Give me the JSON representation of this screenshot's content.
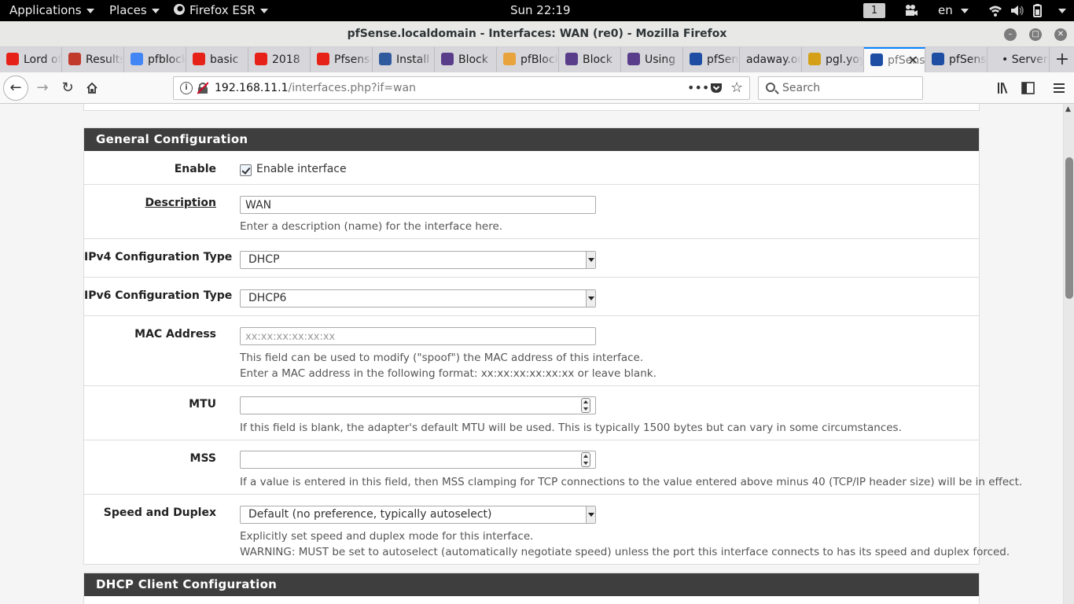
{
  "topbar": {
    "applications": "Applications",
    "places": "Places",
    "app_name": "Firefox ESR",
    "clock": "Sun 22:19",
    "workspace": "1",
    "language": "en"
  },
  "window": {
    "title": "pfSense.localdomain - Interfaces: WAN (re0) - Mozilla Firefox"
  },
  "tabs": [
    {
      "label": "Lord of",
      "icon": "youtube-icon",
      "color": "#e62117"
    },
    {
      "label": "Results",
      "icon": "results-icon",
      "color": "#c0392b"
    },
    {
      "label": "pfblockerng",
      "icon": "google-icon",
      "color": "#4285f4"
    },
    {
      "label": "basic",
      "icon": "youtube-icon",
      "color": "#e62117"
    },
    {
      "label": "2018",
      "icon": "youtube-icon",
      "color": "#e62117"
    },
    {
      "label": "Pfsense",
      "icon": "youtube-icon",
      "color": "#e62117"
    },
    {
      "label": "Install",
      "icon": "info-icon",
      "color": "#2f5a9e"
    },
    {
      "label": "Block",
      "icon": "circle-icon",
      "color": "#5a3d8a"
    },
    {
      "label": "pfBlocker",
      "icon": "forum-icon",
      "color": "#e8a33d"
    },
    {
      "label": "Block",
      "icon": "circle-icon",
      "color": "#5a3d8a"
    },
    {
      "label": "Using",
      "icon": "circle-icon",
      "color": "#5a3d8a"
    },
    {
      "label": "pfSense",
      "icon": "pfsense-icon",
      "color": "#1d4ea3"
    },
    {
      "label": "adaway.org",
      "icon": "",
      "color": ""
    },
    {
      "label": "pgl.yoyo",
      "icon": "file-icon",
      "color": "#d4a017"
    },
    {
      "label": "pfSense",
      "icon": "pfsense-icon",
      "color": "#1d4ea3",
      "active": true
    },
    {
      "label": "pfSense",
      "icon": "pfsense-icon",
      "color": "#1d4ea3"
    },
    {
      "label": "• Server",
      "icon": "",
      "color": ""
    }
  ],
  "nav": {
    "url_host": "192.168.11.1",
    "url_path": "/interfaces.php?if=wan",
    "search_placeholder": "Search"
  },
  "general": {
    "heading": "General Configuration",
    "enable_label": "Enable",
    "enable_text": "Enable interface",
    "description_label": "Description",
    "description_value": "WAN",
    "description_help": "Enter a description (name) for the interface here.",
    "ipv4_label": "IPv4 Configuration Type",
    "ipv4_value": "DHCP",
    "ipv6_label": "IPv6 Configuration Type",
    "ipv6_value": "DHCP6",
    "mac_label": "MAC Address",
    "mac_placeholder": "xx:xx:xx:xx:xx:xx",
    "mac_help1": "This field can be used to modify (\"spoof\") the MAC address of this interface.",
    "mac_help2": "Enter a MAC address in the following format: xx:xx:xx:xx:xx:xx or leave blank.",
    "mtu_label": "MTU",
    "mtu_help": "If this field is blank, the adapter's default MTU will be used. This is typically 1500 bytes but can vary in some circumstances.",
    "mss_label": "MSS",
    "mss_help": "If a value is entered in this field, then MSS clamping for TCP connections to the value entered above minus 40 (TCP/IP header size) will be in effect.",
    "speed_label": "Speed and Duplex",
    "speed_value": "Default (no preference, typically autoselect)",
    "speed_help1": "Explicitly set speed and duplex mode for this interface.",
    "speed_help2": "WARNING: MUST be set to autoselect (automatically negotiate speed) unless the port this interface connects to has its speed and duplex forced."
  },
  "dhcp": {
    "heading": "DHCP Client Configuration"
  }
}
